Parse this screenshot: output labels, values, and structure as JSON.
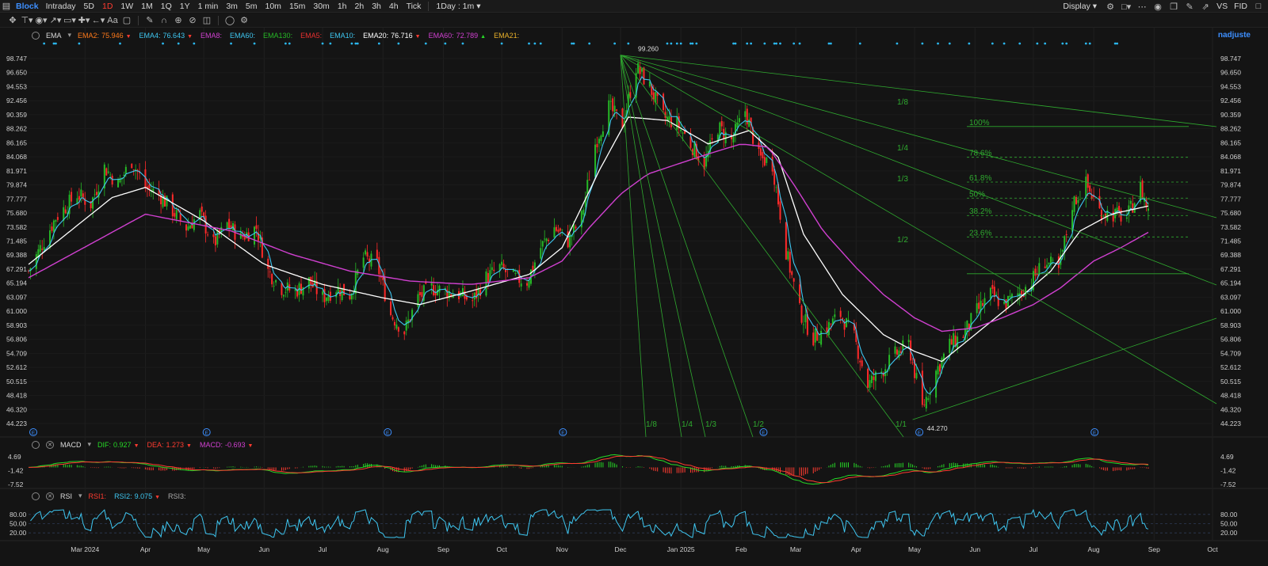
{
  "topbar": {
    "symbol": "Block",
    "timeframes": [
      "Intraday",
      "5D",
      "1D",
      "1W",
      "1M",
      "1Q",
      "1Y",
      "1 min",
      "3m",
      "5m",
      "10m",
      "15m",
      "30m",
      "1h",
      "2h",
      "3h",
      "4h",
      "Tick"
    ],
    "active_timeframe": "1D",
    "interval_select": "1Day : 1m",
    "display_label": "Display",
    "compare_label": "VS",
    "fid_label": "FID"
  },
  "indicators": {
    "ema": {
      "name": "EMA",
      "items": [
        {
          "label": "EMA2:",
          "value": "75.946",
          "arrow": "down",
          "color": "#ff7a1a"
        },
        {
          "label": "EMA4:",
          "value": "76.643",
          "arrow": "down",
          "color": "#3ec6f0"
        },
        {
          "label": "EMA8:",
          "value": "",
          "arrow": "",
          "color": "#d040d0"
        },
        {
          "label": "EMA60:",
          "value": "",
          "arrow": "",
          "color": "#3ec6f0"
        },
        {
          "label": "EMA130:",
          "value": "",
          "arrow": "",
          "color": "#26b926"
        },
        {
          "label": "EMA5:",
          "value": "",
          "arrow": "",
          "color": "#e83030"
        },
        {
          "label": "EMA10:",
          "value": "",
          "arrow": "",
          "color": "#3ec6f0"
        },
        {
          "label": "EMA20:",
          "value": "76.716",
          "arrow": "down",
          "color": "#ffffff"
        },
        {
          "label": "EMA60:",
          "value": "72.789",
          "arrow": "up",
          "color": "#d040d0"
        },
        {
          "label": "EMA21:",
          "value": "",
          "arrow": "",
          "color": "#e8b02a"
        }
      ]
    },
    "macd": {
      "name": "MACD",
      "items": [
        {
          "label": "DIF:",
          "value": "0.927",
          "arrow": "down",
          "color": "#26d926"
        },
        {
          "label": "DEA:",
          "value": "1.273",
          "arrow": "down",
          "color": "#ff3b30"
        },
        {
          "label": "MACD:",
          "value": "-0.693",
          "arrow": "down",
          "color": "#d040d0"
        }
      ]
    },
    "rsi": {
      "name": "RSI",
      "items": [
        {
          "label": "RSI1:",
          "value": "",
          "color": "#ff3b30"
        },
        {
          "label": "RSI2:",
          "value": "9.075",
          "arrow": "down",
          "color": "#3ec6f0"
        },
        {
          "label": "RSI3:",
          "value": "",
          "color": "#aaaaaa"
        }
      ]
    }
  },
  "user": "nadjuste",
  "chart_data": {
    "type": "candlestick",
    "price_axis_ticks": [
      "98.747",
      "96.650",
      "94.553",
      "92.456",
      "90.359",
      "88.262",
      "86.165",
      "84.068",
      "81.971",
      "79.874",
      "77.777",
      "75.680",
      "73.582",
      "71.485",
      "69.388",
      "67.291",
      "65.194",
      "63.097",
      "61.000",
      "58.903",
      "56.806",
      "54.709",
      "52.612",
      "50.515",
      "48.418",
      "46.320",
      "44.223"
    ],
    "price_range": [
      44.223,
      98.747
    ],
    "x_labels": [
      "Mar 2024",
      "Apr",
      "May",
      "Jun",
      "Jul",
      "Aug",
      "Sep",
      "Oct",
      "Nov",
      "Dec",
      "Jan 2025",
      "Feb",
      "Mar",
      "Apr",
      "May",
      "Jun",
      "Jul",
      "Aug",
      "Sep",
      "Oct"
    ],
    "x_label_dates": [
      "2024-03-01",
      "2024-04-01",
      "2024-05-01",
      "2024-06-01",
      "2024-07-01",
      "2024-08-01",
      "2024-09-01",
      "2024-10-01",
      "2024-11-01",
      "2024-12-01",
      "2025-01-01",
      "2025-02-01",
      "2025-03-01",
      "2025-04-01",
      "2025-05-01",
      "2025-06-01",
      "2025-07-01",
      "2025-08-01",
      "2025-09-01",
      "2025-10-01"
    ],
    "x_range": [
      "2024-02-01",
      "2025-10-01"
    ],
    "last_date": "2025-08-29",
    "high_annotation": {
      "value": "99.260",
      "date": "2024-12-01"
    },
    "low_annotation": {
      "value": "44.270",
      "date": "2025-04-30"
    },
    "close_path": [
      [
        "2024-02-01",
        67.0
      ],
      [
        "2024-02-15",
        75.0
      ],
      [
        "2024-02-26",
        78.5
      ],
      [
        "2024-03-04",
        77.0
      ],
      [
        "2024-03-11",
        82.5
      ],
      [
        "2024-03-18",
        80.0
      ],
      [
        "2024-03-25",
        83.5
      ],
      [
        "2024-04-01",
        79.5
      ],
      [
        "2024-04-08",
        78.5
      ],
      [
        "2024-04-15",
        76.0
      ],
      [
        "2024-04-22",
        73.5
      ],
      [
        "2024-04-29",
        75.5
      ],
      [
        "2024-05-06",
        71.0
      ],
      [
        "2024-05-13",
        74.0
      ],
      [
        "2024-05-20",
        72.0
      ],
      [
        "2024-05-28",
        73.5
      ],
      [
        "2024-06-03",
        67.0
      ],
      [
        "2024-06-10",
        64.5
      ],
      [
        "2024-06-17",
        64.0
      ],
      [
        "2024-06-24",
        65.5
      ],
      [
        "2024-07-01",
        63.0
      ],
      [
        "2024-07-08",
        64.5
      ],
      [
        "2024-07-15",
        63.5
      ],
      [
        "2024-07-22",
        69.0
      ],
      [
        "2024-07-29",
        68.0
      ],
      [
        "2024-08-05",
        60.5
      ],
      [
        "2024-08-12",
        58.0
      ],
      [
        "2024-08-19",
        63.0
      ],
      [
        "2024-08-26",
        64.5
      ],
      [
        "2024-09-02",
        64.0
      ],
      [
        "2024-09-09",
        63.5
      ],
      [
        "2024-09-16",
        62.5
      ],
      [
        "2024-09-23",
        66.0
      ],
      [
        "2024-09-30",
        67.5
      ],
      [
        "2024-10-07",
        66.0
      ],
      [
        "2024-10-14",
        65.5
      ],
      [
        "2024-10-21",
        70.5
      ],
      [
        "2024-10-28",
        73.5
      ],
      [
        "2024-11-04",
        71.5
      ],
      [
        "2024-11-11",
        75.0
      ],
      [
        "2024-11-18",
        86.0
      ],
      [
        "2024-11-25",
        91.5
      ],
      [
        "2024-12-02",
        89.0
      ],
      [
        "2024-12-09",
        97.5
      ],
      [
        "2024-12-16",
        94.5
      ],
      [
        "2024-12-23",
        90.0
      ],
      [
        "2024-12-30",
        89.0
      ],
      [
        "2025-01-06",
        86.0
      ],
      [
        "2025-01-13",
        83.0
      ],
      [
        "2025-01-20",
        88.5
      ],
      [
        "2025-01-27",
        86.5
      ],
      [
        "2025-02-03",
        91.0
      ],
      [
        "2025-02-10",
        84.0
      ],
      [
        "2025-02-17",
        83.0
      ],
      [
        "2025-02-24",
        70.0
      ],
      [
        "2025-03-03",
        61.0
      ],
      [
        "2025-03-10",
        57.0
      ],
      [
        "2025-03-17",
        58.5
      ],
      [
        "2025-03-24",
        60.5
      ],
      [
        "2025-03-31",
        57.0
      ],
      [
        "2025-04-07",
        50.0
      ],
      [
        "2025-04-14",
        52.0
      ],
      [
        "2025-04-21",
        54.5
      ],
      [
        "2025-04-28",
        56.0
      ],
      [
        "2025-05-05",
        46.5
      ],
      [
        "2025-05-12",
        52.0
      ],
      [
        "2025-05-19",
        56.0
      ],
      [
        "2025-05-26",
        57.5
      ],
      [
        "2025-06-02",
        61.0
      ],
      [
        "2025-06-09",
        63.5
      ],
      [
        "2025-06-16",
        62.0
      ],
      [
        "2025-06-23",
        63.5
      ],
      [
        "2025-06-30",
        65.5
      ],
      [
        "2025-07-07",
        68.5
      ],
      [
        "2025-07-14",
        67.0
      ],
      [
        "2025-07-21",
        77.0
      ],
      [
        "2025-07-28",
        80.0
      ],
      [
        "2025-08-04",
        76.0
      ],
      [
        "2025-08-11",
        75.5
      ],
      [
        "2025-08-18",
        75.0
      ],
      [
        "2025-08-25",
        79.5
      ],
      [
        "2025-08-29",
        75.9
      ]
    ],
    "ema_slow_path": [
      [
        "2024-02-01",
        66.0
      ],
      [
        "2024-04-01",
        75.5
      ],
      [
        "2024-05-15",
        73.0
      ],
      [
        "2024-06-15",
        69.5
      ],
      [
        "2024-07-15",
        67.0
      ],
      [
        "2024-08-15",
        65.5
      ],
      [
        "2024-09-15",
        65.0
      ],
      [
        "2024-10-15",
        66.0
      ],
      [
        "2024-11-01",
        68.5
      ],
      [
        "2024-11-15",
        73.5
      ],
      [
        "2024-12-01",
        78.5
      ],
      [
        "2024-12-15",
        81.5
      ],
      [
        "2025-01-15",
        84.5
      ],
      [
        "2025-02-01",
        86.0
      ],
      [
        "2025-02-15",
        85.5
      ],
      [
        "2025-03-01",
        79.5
      ],
      [
        "2025-03-15",
        73.0
      ],
      [
        "2025-04-01",
        67.5
      ],
      [
        "2025-04-15",
        63.5
      ],
      [
        "2025-05-01",
        60.0
      ],
      [
        "2025-05-15",
        58.0
      ],
      [
        "2025-06-01",
        58.5
      ],
      [
        "2025-06-15",
        60.0
      ],
      [
        "2025-07-01",
        62.0
      ],
      [
        "2025-07-15",
        64.5
      ],
      [
        "2025-08-01",
        68.5
      ],
      [
        "2025-08-15",
        70.5
      ],
      [
        "2025-08-29",
        72.789
      ]
    ],
    "ema_mid_path": [
      [
        "2024-02-01",
        68.0
      ],
      [
        "2024-03-15",
        78.0
      ],
      [
        "2024-04-01",
        79.5
      ],
      [
        "2024-05-01",
        74.5
      ],
      [
        "2024-06-01",
        68.0
      ],
      [
        "2024-07-01",
        65.0
      ],
      [
        "2024-08-01",
        63.0
      ],
      [
        "2024-08-20",
        62.0
      ],
      [
        "2024-09-15",
        64.0
      ],
      [
        "2024-10-15",
        66.5
      ],
      [
        "2024-11-01",
        70.5
      ],
      [
        "2024-11-20",
        82.0
      ],
      [
        "2024-12-05",
        90.0
      ],
      [
        "2024-12-25",
        89.5
      ],
      [
        "2025-01-15",
        86.0
      ],
      [
        "2025-02-05",
        88.0
      ],
      [
        "2025-02-20",
        84.0
      ],
      [
        "2025-03-05",
        72.5
      ],
      [
        "2025-03-25",
        63.5
      ],
      [
        "2025-04-15",
        57.5
      ],
      [
        "2025-05-01",
        55.0
      ],
      [
        "2025-05-15",
        53.5
      ],
      [
        "2025-06-01",
        57.5
      ],
      [
        "2025-06-20",
        62.0
      ],
      [
        "2025-07-10",
        67.0
      ],
      [
        "2025-07-25",
        73.0
      ],
      [
        "2025-08-10",
        75.5
      ],
      [
        "2025-08-29",
        76.716
      ]
    ],
    "fib_levels": [
      {
        "label": "100%",
        "value": 88.6
      },
      {
        "label": "78.6%",
        "value": 84.0
      },
      {
        "label": "61.8%",
        "value": 80.3
      },
      {
        "label": "50%",
        "value": 77.9
      },
      {
        "label": "38.2%",
        "value": 75.3
      },
      {
        "label": "23.6%",
        "value": 72.1
      }
    ],
    "gann_fan_labels_top": [
      "1/8",
      "1/4",
      "1/3",
      "1/2"
    ],
    "gann_fan_labels_bottom": [
      "1/8",
      "1/4",
      "1/3",
      "1/2",
      "1/1"
    ],
    "event_marker_dates": [
      "2024-02-01",
      "2024-04-30",
      "2024-08-01",
      "2024-10-30",
      "2025-02-10",
      "2025-05-01",
      "2025-07-30"
    ],
    "event_marker_glyph": "E",
    "macd_axis_ticks": [
      "4.69",
      "-1.42",
      "-7.52"
    ],
    "macd_range": [
      -7.52,
      4.69
    ],
    "rsi_axis_ticks": [
      "80.00",
      "50.00",
      "20.00"
    ],
    "rsi_range": [
      0,
      100
    ],
    "colors": {
      "up": "#26b926",
      "down": "#ff2a2a",
      "ema_fast": "#3ec6f0",
      "ema_mid": "#ffffff",
      "ema_slow": "#d040d0",
      "fib": "#2faa2f",
      "grid": "#1f1f1f",
      "axis_text": "#d0d0d0",
      "macd_dif": "#26d926",
      "macd_dea": "#ff3b30",
      "rsi_line": "#3ec6f0",
      "marker": "#3d8fff",
      "dot": "#2bb8f0"
    }
  }
}
